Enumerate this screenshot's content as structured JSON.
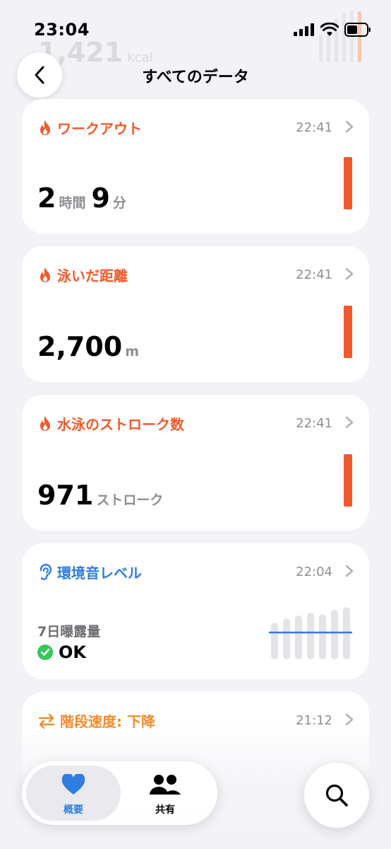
{
  "status": {
    "time": "23:04"
  },
  "background": {
    "value": "1,421",
    "unit": "kcal"
  },
  "nav": {
    "title": "すべてのデータ"
  },
  "cards": [
    {
      "title": "ワークアウト",
      "time": "22:41",
      "value_hours": "2",
      "unit_hours": "時間",
      "value_minutes": "9",
      "unit_minutes": "分",
      "icon": "flame-icon"
    },
    {
      "title": "泳いだ距離",
      "time": "22:41",
      "value": "2,700",
      "unit": "m",
      "icon": "flame-icon"
    },
    {
      "title": "水泳のストローク数",
      "time": "22:41",
      "value": "971",
      "unit": "ストローク",
      "icon": "flame-icon"
    },
    {
      "title": "環境音レベル",
      "time": "22:04",
      "subtitle": "7日曝露量",
      "status": "OK",
      "icon": "ear-icon"
    },
    {
      "title": "階段速度: 下降",
      "time": "21:12",
      "icon": "arrows-icon"
    }
  ],
  "tabs": [
    {
      "label": "概要",
      "icon": "heart-icon"
    },
    {
      "label": "共有",
      "icon": "people-icon"
    }
  ],
  "colors": {
    "orange": "#f0592a",
    "blue": "#2f7de1",
    "amber": "#f08a2a",
    "ok_green": "#34c759"
  }
}
